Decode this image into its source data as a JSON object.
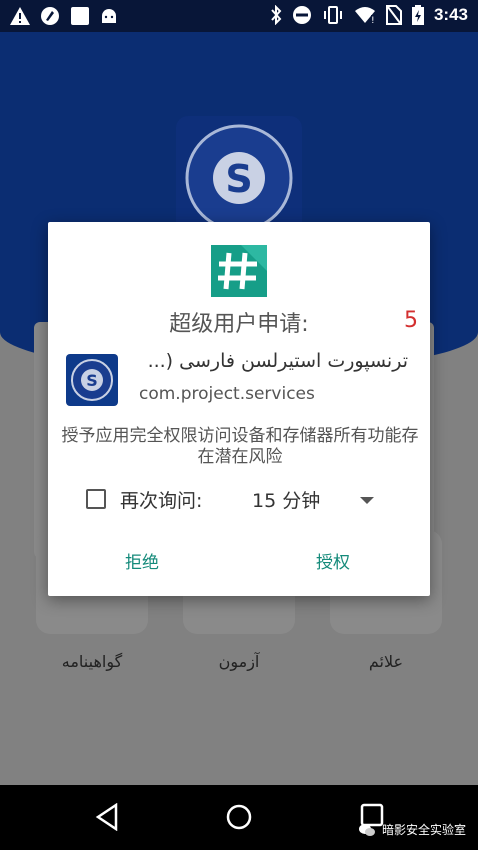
{
  "status_bar": {
    "time": "3:43",
    "left_icons": [
      "warning-icon",
      "android-debug-icon",
      "screenshot-icon",
      "android-icon"
    ],
    "right_icons": [
      "bluetooth-icon",
      "do-not-disturb-icon",
      "vibrate-icon",
      "wifi-icon",
      "no-sim-icon",
      "battery-charging-icon"
    ]
  },
  "background_app": {
    "tiles": [
      {
        "label": "گواهینامه"
      },
      {
        "label": "آزمون"
      },
      {
        "label": "علائم"
      }
    ]
  },
  "dialog": {
    "title": "超级用户申请:",
    "countdown": "5",
    "app_name": "ترنسپورت استیرلسن فارسی (...",
    "app_package": "com.project.services",
    "warning": "授予应用完全权限访问设备和存储器所有功能存在潜在风险",
    "remember_label": "再次询问:",
    "duration": "15 分钟",
    "deny_label": "拒绝",
    "grant_label": "授权"
  },
  "watermark": {
    "text": "暗影安全实验室"
  },
  "colors": {
    "accent": "#148a7a",
    "countdown": "#d32f2f",
    "banner": "#0b2d72"
  }
}
